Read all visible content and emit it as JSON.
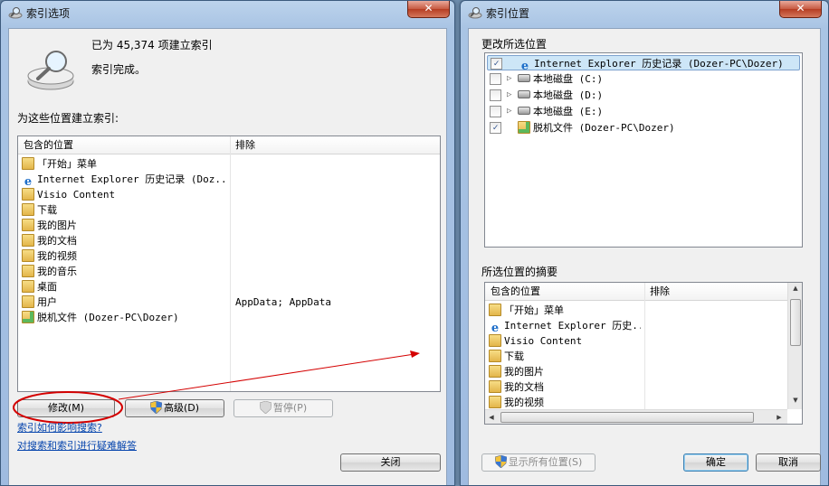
{
  "left_window": {
    "title": "索引选项",
    "close_label": "✕",
    "status_count": "已为 45,374 项建立索引",
    "status_state": "索引完成。",
    "locations_label": "为这些位置建立索引:",
    "columns": {
      "included": "包含的位置",
      "excluded": "排除"
    },
    "rows": [
      {
        "icon": "start-menu-folder-icon",
        "name": "「开始」菜单",
        "exclude": ""
      },
      {
        "icon": "internet-explorer-icon",
        "name": "Internet Explorer 历史记录 (Doz...",
        "exclude": ""
      },
      {
        "icon": "folder-icon",
        "name": "Visio Content",
        "exclude": ""
      },
      {
        "icon": "downloads-folder-icon",
        "name": "下载",
        "exclude": ""
      },
      {
        "icon": "pictures-folder-icon",
        "name": "我的图片",
        "exclude": ""
      },
      {
        "icon": "documents-folder-icon",
        "name": "我的文档",
        "exclude": ""
      },
      {
        "icon": "videos-folder-icon",
        "name": "我的视频",
        "exclude": ""
      },
      {
        "icon": "music-folder-icon",
        "name": "我的音乐",
        "exclude": ""
      },
      {
        "icon": "desktop-folder-icon",
        "name": "桌面",
        "exclude": ""
      },
      {
        "icon": "users-folder-icon",
        "name": "用户",
        "exclude": "AppData; AppData"
      },
      {
        "icon": "offline-files-icon",
        "name": "脱机文件 (Dozer-PC\\Dozer)",
        "exclude": ""
      }
    ],
    "buttons": {
      "modify": "修改(M)",
      "advanced": "高级(D)",
      "pause": "暂停(P)",
      "close": "关闭"
    },
    "links": {
      "how_affects": "索引如何影响搜索?",
      "troubleshoot": "对搜索和索引进行疑难解答"
    }
  },
  "right_window": {
    "title": "索引位置",
    "close_label": "✕",
    "change_label": "更改所选位置",
    "tree": [
      {
        "checked": true,
        "expandable": false,
        "icon": "internet-explorer-icon",
        "name": "Internet Explorer 历史记录 (Dozer-PC\\Dozer)",
        "selected": true
      },
      {
        "checked": false,
        "expandable": true,
        "icon": "local-disk-system-icon",
        "name": "本地磁盘 (C:)",
        "selected": false
      },
      {
        "checked": false,
        "expandable": true,
        "icon": "local-disk-icon",
        "name": "本地磁盘 (D:)",
        "selected": false
      },
      {
        "checked": false,
        "expandable": true,
        "icon": "local-disk-icon",
        "name": "本地磁盘 (E:)",
        "selected": false
      },
      {
        "checked": true,
        "expandable": false,
        "icon": "offline-files-icon",
        "name": "脱机文件 (Dozer-PC\\Dozer)",
        "selected": false
      }
    ],
    "summary_label": "所选位置的摘要",
    "columns": {
      "included": "包含的位置",
      "excluded": "排除"
    },
    "summary_rows": [
      {
        "icon": "start-menu-folder-icon",
        "name": "「开始」菜单"
      },
      {
        "icon": "internet-explorer-icon",
        "name": "Internet Explorer 历史..."
      },
      {
        "icon": "folder-icon",
        "name": "Visio Content"
      },
      {
        "icon": "downloads-folder-icon",
        "name": "下载"
      },
      {
        "icon": "pictures-folder-icon",
        "name": "我的图片"
      },
      {
        "icon": "documents-folder-icon",
        "name": "我的文档"
      },
      {
        "icon": "videos-folder-icon",
        "name": "我的视频"
      }
    ],
    "buttons": {
      "show_all": "显示所有位置(S)",
      "ok": "确定",
      "cancel": "取消"
    }
  },
  "colors": {
    "annotation_red": "#d40000",
    "link_blue": "#0645ad",
    "selection": "#cde6f7"
  }
}
